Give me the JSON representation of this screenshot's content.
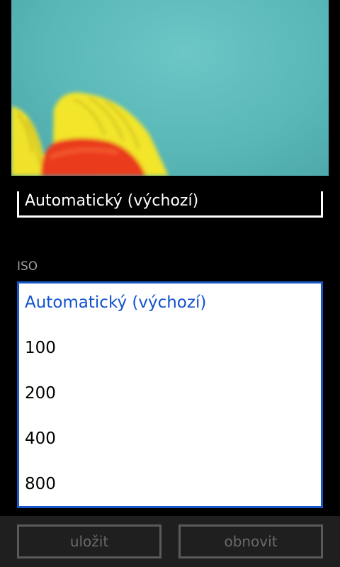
{
  "picker": {
    "current_value": "Automatický (výchozí)"
  },
  "iso": {
    "label": "ISO",
    "options": [
      {
        "label": "Automatický (výchozí)",
        "selected": true
      },
      {
        "label": "100",
        "selected": false
      },
      {
        "label": "200",
        "selected": false
      },
      {
        "label": "400",
        "selected": false
      },
      {
        "label": "800",
        "selected": false
      }
    ]
  },
  "app_bar": {
    "save_label": "uložit",
    "reset_label": "obnovit"
  },
  "colors": {
    "accent": "#1656c6",
    "selected_text": "#1352cf",
    "background": "#000000",
    "app_bar": "#1f1f1f",
    "disabled_text": "#6a6a6a"
  }
}
